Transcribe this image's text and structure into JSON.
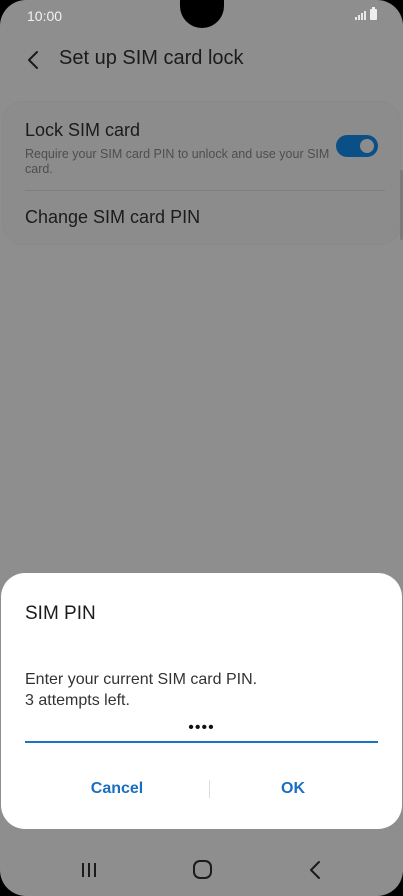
{
  "status_bar": {
    "time": "10:00"
  },
  "header": {
    "title": "Set up SIM card lock"
  },
  "settings": {
    "lock_sim": {
      "title": "Lock SIM card",
      "subtitle": "Require your SIM card PIN to unlock and use your SIM card.",
      "enabled": true
    },
    "change_pin": {
      "title": "Change SIM card PIN"
    }
  },
  "dialog": {
    "title": "SIM PIN",
    "message_line1": "Enter your current SIM card PIN.",
    "message_line2": "3 attempts left.",
    "pin_value": "••••",
    "cancel_label": "Cancel",
    "ok_label": "OK"
  },
  "colors": {
    "accent": "#1a6fbf",
    "overlay": "#8a8a8a",
    "toggle_on": "#0b4f87"
  },
  "icons": {
    "back": "back-arrow-icon",
    "nav_recents": "recents-icon",
    "nav_home": "home-icon",
    "nav_back": "nav-back-icon"
  }
}
